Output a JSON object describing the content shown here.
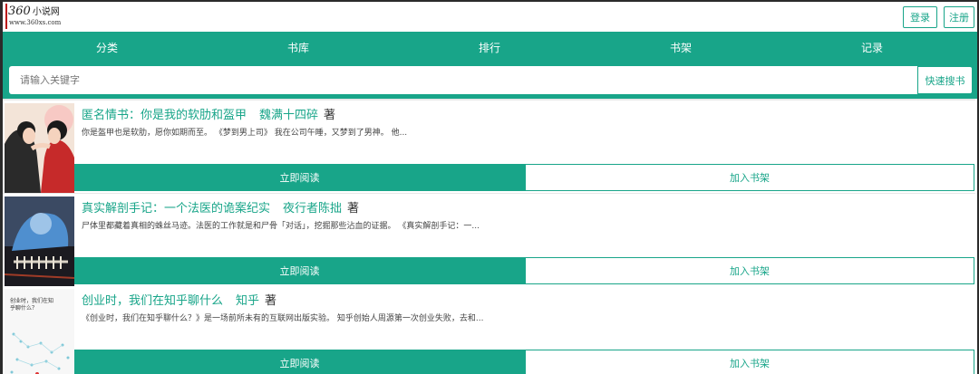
{
  "header": {
    "logo_mark": "360",
    "logo_cn": "小说网",
    "logo_url": "www.360xs.com",
    "login_label": "登录",
    "register_label": "注册"
  },
  "nav": {
    "items": [
      "分类",
      "书库",
      "排行",
      "书架",
      "记录"
    ]
  },
  "search": {
    "placeholder": "请输入关键字",
    "button_label": "快速搜书"
  },
  "books": [
    {
      "title": "匿名情书：你是我的软肋和盔甲",
      "author": "魏满十四碎",
      "author_suffix": "著",
      "description": "你是盔甲也是软肋，愿你如期而至。 《梦到男上司》 我在公司午睡，又梦到了男神。 他...",
      "read_label": "立即阅读",
      "shelf_label": "加入书架"
    },
    {
      "title": "真实解剖手记：一个法医的诡案纪实",
      "author": "夜行者陈拙",
      "author_suffix": "著",
      "description": "尸体里都藏着真相的蛛丝马迹。法医的工作就是和尸骨「对话」，挖掘那些沾血的证据。 《真实解剖手记：一...",
      "read_label": "立即阅读",
      "shelf_label": "加入书架"
    },
    {
      "title": "创业时，我们在知乎聊什么",
      "author": "知乎",
      "author_suffix": "著",
      "description": "《创业时，我们在知乎聊什么？》是一场前所未有的互联网出版实验。 知乎创始人周源第一次创业失败，去和...",
      "cover_text": "创业时，我们在知乎聊什么？",
      "read_label": "立即阅读",
      "shelf_label": "加入书架"
    }
  ],
  "colors": {
    "accent": "#18a589",
    "white": "#ffffff"
  }
}
